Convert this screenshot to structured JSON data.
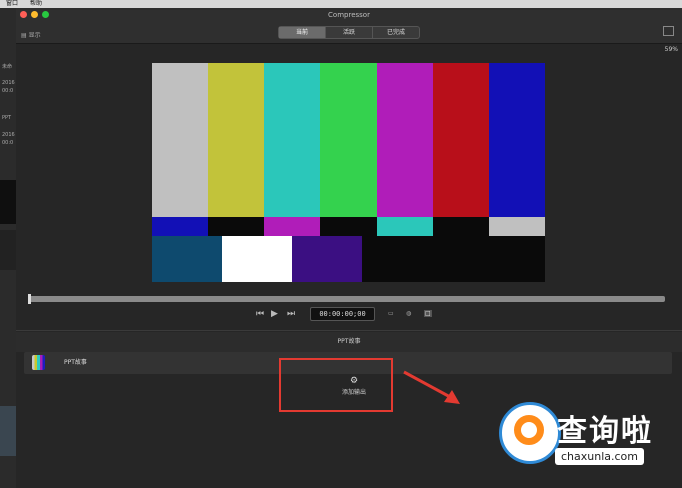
{
  "menubar": {
    "items": [
      "窗口",
      "帮助"
    ]
  },
  "left_strip": {
    "lines": [
      "未命",
      "2016",
      "00:0",
      "PPT",
      "2016",
      "00:0"
    ]
  },
  "window": {
    "title": "Compressor",
    "save_label": "显示",
    "tabs": [
      {
        "label": "当前",
        "active": true
      },
      {
        "label": "活跃",
        "active": false
      },
      {
        "label": "已完成",
        "active": false
      }
    ],
    "zoom": "59%"
  },
  "viewer": {
    "top_bars": [
      "#c0c0c0",
      "#c2c33a",
      "#2bc7ba",
      "#34d24e",
      "#b01db9",
      "#b80f1a",
      "#1210b6"
    ],
    "mid_bars": [
      "#1210b6",
      "#0a0a0a",
      "#b01db9",
      "#0a0a0a",
      "#2bc7ba",
      "#0a0a0a",
      "#c0c0c0"
    ],
    "bottom_blocks": [
      "#0e4a6e",
      "#ffffff",
      "#3b0f82",
      "#0a0a0a"
    ]
  },
  "transport": {
    "timecode": "00:00:00;00",
    "prev_icon": "skip-back-icon",
    "play_icon": "play-icon",
    "next_icon": "skip-forward-icon"
  },
  "batch": {
    "header": "PPT故事",
    "file_name": "PPT故事",
    "add_output_label": "添加输出",
    "add_output_icon": "gear-icon"
  },
  "annotation": {
    "box_color": "#e33a31"
  },
  "watermark": {
    "text": "查询啦",
    "url": "chaxunla.com"
  }
}
